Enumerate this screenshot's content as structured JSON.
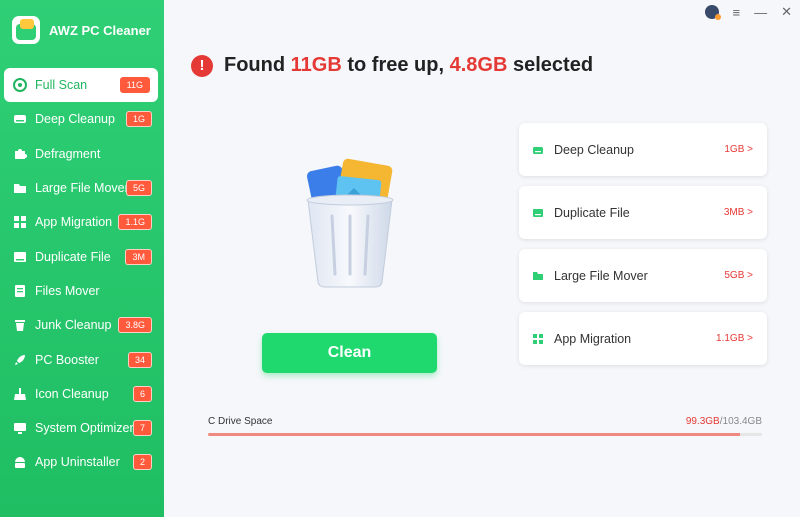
{
  "app": {
    "name": "AWZ PC Cleaner"
  },
  "sidebar": {
    "items": [
      {
        "label": "Full Scan",
        "badge": "11G",
        "icon": "scan-icon",
        "active": true
      },
      {
        "label": "Deep Cleanup",
        "badge": "1G",
        "icon": "drive-icon"
      },
      {
        "label": "Defragment",
        "badge": "",
        "icon": "puzzle-icon"
      },
      {
        "label": "Large File Mover",
        "badge": "5G",
        "icon": "folder-icon"
      },
      {
        "label": "App Migration",
        "badge": "1.1G",
        "icon": "apps-icon"
      },
      {
        "label": "Duplicate File",
        "badge": "3M",
        "icon": "duplicate-icon"
      },
      {
        "label": "Files Mover",
        "badge": "",
        "icon": "files-icon"
      },
      {
        "label": "Junk Cleanup",
        "badge": "3.8G",
        "icon": "trash-icon"
      },
      {
        "label": "PC Booster",
        "badge": "34",
        "icon": "rocket-icon"
      },
      {
        "label": "Icon Cleanup",
        "badge": "6",
        "icon": "broom-icon"
      },
      {
        "label": "System Optimizer",
        "badge": "7",
        "icon": "monitor-icon"
      },
      {
        "label": "App Uninstaller",
        "badge": "2",
        "icon": "android-icon"
      }
    ]
  },
  "header": {
    "prefix": "Found",
    "total": "11GB",
    "middle": "to free up,",
    "selected": "4.8GB",
    "suffix": "selected"
  },
  "cards": [
    {
      "label": "Deep Cleanup",
      "size": "1GB >",
      "icon": "drive-icon"
    },
    {
      "label": "Duplicate File",
      "size": "3MB >",
      "icon": "duplicate-icon"
    },
    {
      "label": "Large File Mover",
      "size": "5GB >",
      "icon": "folder-icon"
    },
    {
      "label": "App Migration",
      "size": "1.1GB >",
      "icon": "apps-icon"
    }
  ],
  "clean_button": "Clean",
  "drive": {
    "label": "C Drive Space",
    "used": "99.3GB",
    "total": "/103.4GB",
    "fill_fraction": 0.96
  },
  "window_controls": {
    "menu": "≡",
    "minimize": "—",
    "close": "✕"
  },
  "colors": {
    "accent": "#1fd86e",
    "sidebar": "#2fcf76",
    "alert": "#e53935",
    "badge": "#ff5a3c"
  }
}
